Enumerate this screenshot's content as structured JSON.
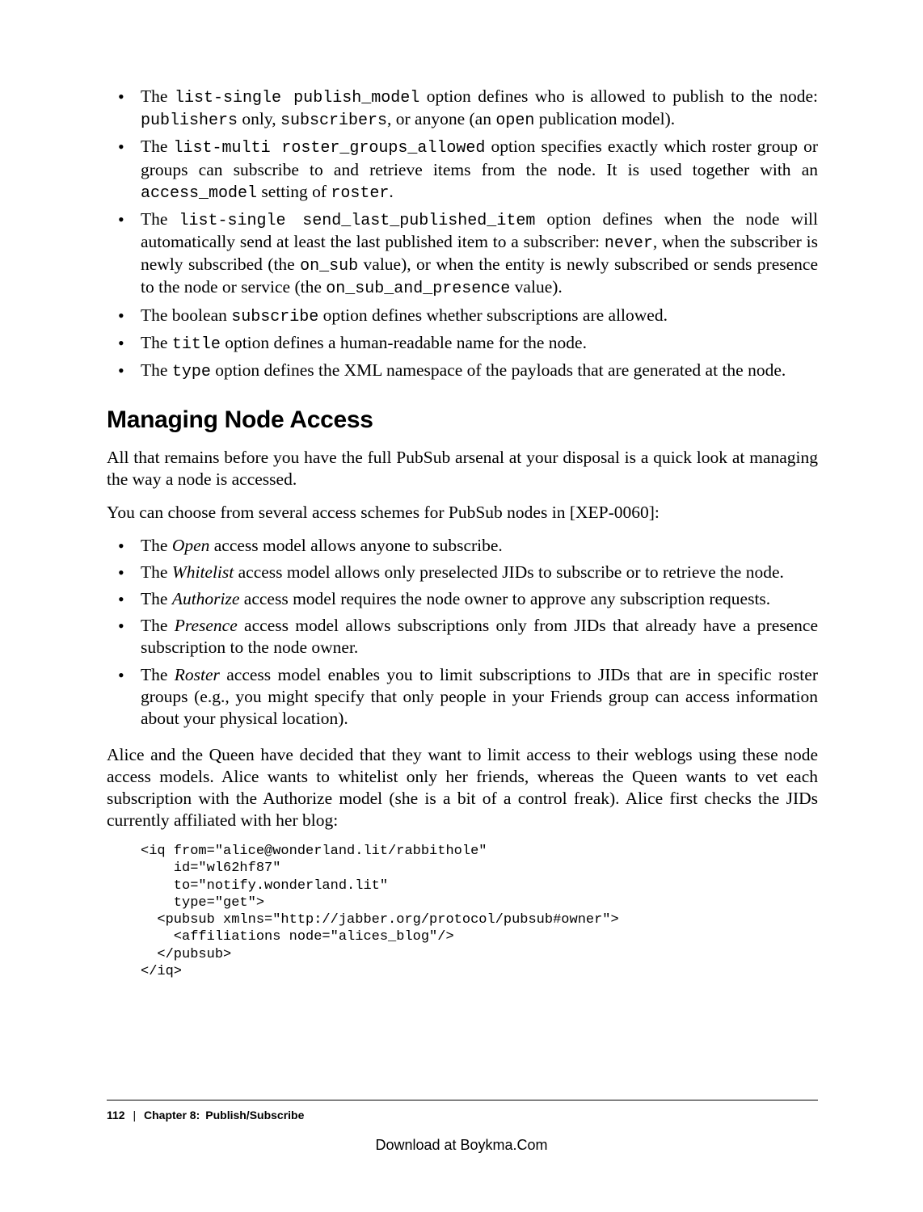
{
  "list1": {
    "i0": {
      "t0": "The ",
      "c0": "list-single publish_model",
      "t1": " option defines who is allowed to publish to the node: ",
      "c1": "publishers",
      "t2": " only, ",
      "c2": "subscribers",
      "t3": ", or anyone (an ",
      "c3": "open",
      "t4": " publication model)."
    },
    "i1": {
      "t0": "The ",
      "c0": "list-multi roster_groups_allowed",
      "t1": " option specifies exactly which roster group or groups can subscribe to and retrieve items from the node. It is used together with an ",
      "c1": "access_model",
      "t2": " setting of ",
      "c2": "roster",
      "t3": "."
    },
    "i2": {
      "t0": "The ",
      "c0": "list-single send_last_published_item",
      "t1": " option defines when the node will automatically send at least the last published item to a subscriber: ",
      "c1": "never",
      "t2": ", when the subscriber is newly subscribed (the ",
      "c2": "on_sub",
      "t3": " value), or when the entity is newly subscribed or sends presence to the node or service (the ",
      "c3": "on_sub_and_presence",
      "t4": " value)."
    },
    "i3": {
      "t0": "The boolean ",
      "c0": "subscribe",
      "t1": " option defines whether subscriptions are allowed."
    },
    "i4": {
      "t0": "The ",
      "c0": "title",
      "t1": " option defines a human-readable name for the node."
    },
    "i5": {
      "t0": "The ",
      "c0": "type",
      "t1": " option defines the XML namespace of the payloads that are generated at the node."
    }
  },
  "heading": "Managing Node Access",
  "para1": "All that remains before you have the full PubSub arsenal at your disposal is a quick look at managing the way a node is accessed.",
  "para2": "You can choose from several access schemes for PubSub nodes in [XEP-0060]:",
  "list2": {
    "i0": {
      "t0": "The ",
      "e0": "Open",
      "t1": " access model allows anyone to subscribe."
    },
    "i1": {
      "t0": "The ",
      "e0": "Whitelist",
      "t1": " access model allows only preselected JIDs to subscribe or to retrieve the node."
    },
    "i2": {
      "t0": "The ",
      "e0": "Authorize",
      "t1": " access model requires the node owner to approve any subscription requests."
    },
    "i3": {
      "t0": "The ",
      "e0": "Presence",
      "t1": " access model allows subscriptions only from JIDs that already have a presence subscription to the node owner."
    },
    "i4": {
      "t0": "The ",
      "e0": "Roster",
      "t1": " access model enables you to limit subscriptions to JIDs that are in specific roster groups (e.g., you might specify that only people in your Friends group can access information about your physical location)."
    }
  },
  "para3": "Alice and the Queen have decided that they want to limit access to their weblogs using these node access models. Alice wants to whitelist only her friends, whereas the Queen wants to vet each subscription with the Authorize model (she is a bit of a control freak). Alice first checks the JIDs currently affiliated with her blog:",
  "code": "<iq from=\"alice@wonderland.lit/rabbithole\"\n    id=\"wl62hf87\"\n    to=\"notify.wonderland.lit\"\n    type=\"get\">\n  <pubsub xmlns=\"http://jabber.org/protocol/pubsub#owner\">\n    <affiliations node=\"alices_blog\"/>\n  </pubsub>\n</iq>",
  "footer": {
    "page": "112",
    "sep": "|",
    "chapter": "Chapter 8: Publish/Subscribe"
  },
  "download": "Download at Boykma.Com"
}
